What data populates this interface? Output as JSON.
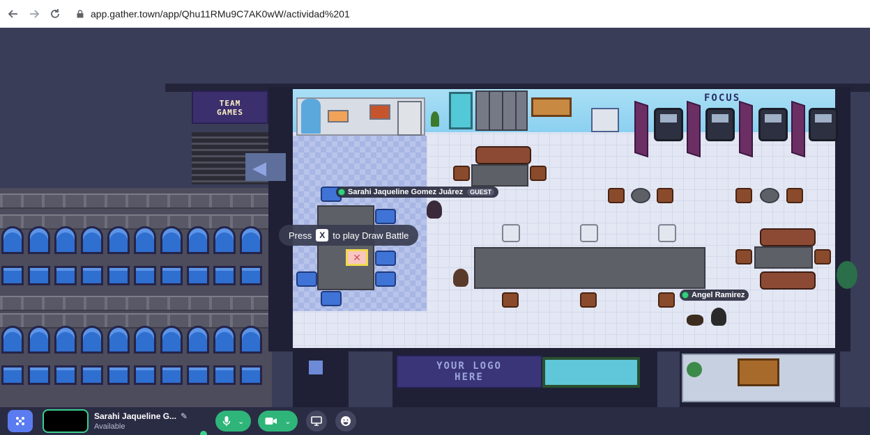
{
  "browser": {
    "back_icon": "arrow-left-icon",
    "forward_icon": "arrow-right-icon",
    "reload_icon": "reload-icon",
    "url": "app.gather.town/app/Qhu11RMu9C7AK0wW/actividad%201"
  },
  "map": {
    "team_games_line1": "TEAM",
    "team_games_line2": "GAMES",
    "focus_label": "FOCUS",
    "logo_line1": "YOUR LOGO",
    "logo_line2": "HERE",
    "press_prefix": "Press",
    "press_key": "X",
    "press_suffix": "to play Draw Battle",
    "players": [
      {
        "name": "Sarahi Jaqueline Gomez Juárez",
        "badge": "GUEST"
      },
      {
        "name": "Angel Ramirez"
      }
    ]
  },
  "toolbar": {
    "user_name": "Sarahi Jaqueline G...",
    "user_status": "Available",
    "icons": {
      "logo": "gather-logo-icon",
      "edit": "pencil-icon",
      "mic": "microphone-icon",
      "camera": "camera-icon",
      "screen": "screen-share-icon",
      "emoji": "emoji-icon"
    }
  },
  "colors": {
    "toolbar_bg": "#2a2c44",
    "active_green": "#2fb57a",
    "floor": "#e3e7f4",
    "background": "#3a3d58"
  }
}
